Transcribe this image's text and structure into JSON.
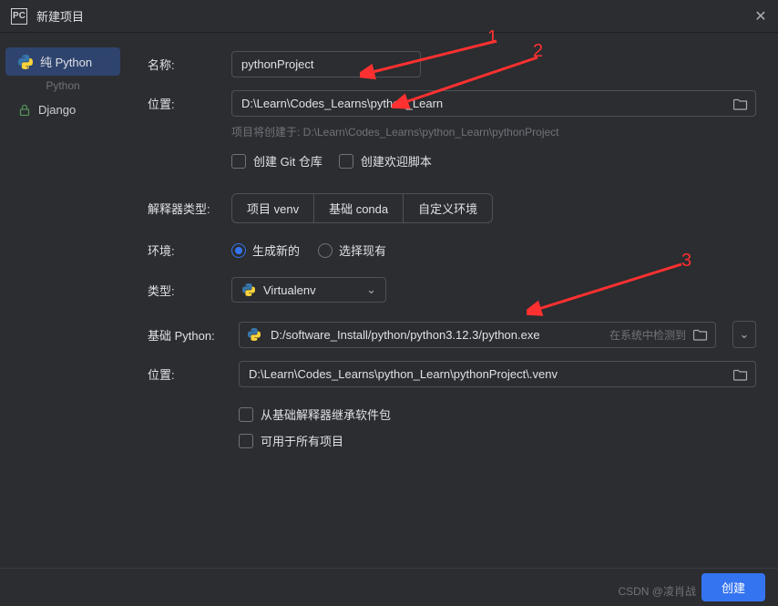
{
  "title": "新建项目",
  "sidebar": {
    "items": [
      {
        "label": "纯 Python"
      },
      {
        "label": "Django"
      }
    ],
    "subtitle": "Python"
  },
  "form": {
    "name_label": "名称:",
    "name_value": "pythonProject",
    "location_label": "位置:",
    "location_value": "D:\\Learn\\Codes_Learns\\python_Learn",
    "hint": "项目将创建于: D:\\Learn\\Codes_Learns\\python_Learn\\pythonProject",
    "git_checkbox": "创建 Git 仓库",
    "welcome_checkbox": "创建欢迎脚本",
    "interpreter_type_label": "解释器类型:",
    "interpreter_options": [
      "项目 venv",
      "基础 conda",
      "自定义环境"
    ],
    "env_label": "环境:",
    "env_generate": "生成新的",
    "env_select": "选择现有",
    "type_label": "类型:",
    "type_value": "Virtualenv",
    "base_python_label": "基础 Python:",
    "base_python_value": "D:/software_Install/python/python3.12.3/python.exe",
    "base_python_hint": "在系统中检测到",
    "venv_location_label": "位置:",
    "venv_location_value": "D:\\Learn\\Codes_Learns\\python_Learn\\pythonProject\\.venv",
    "inherit_checkbox": "从基础解释器继承软件包",
    "available_checkbox": "可用于所有项目"
  },
  "footer": {
    "create_button": "创建"
  },
  "annotations": {
    "one": "1",
    "two": "2",
    "three": "3"
  },
  "watermark": "CSDN @凌肖战"
}
